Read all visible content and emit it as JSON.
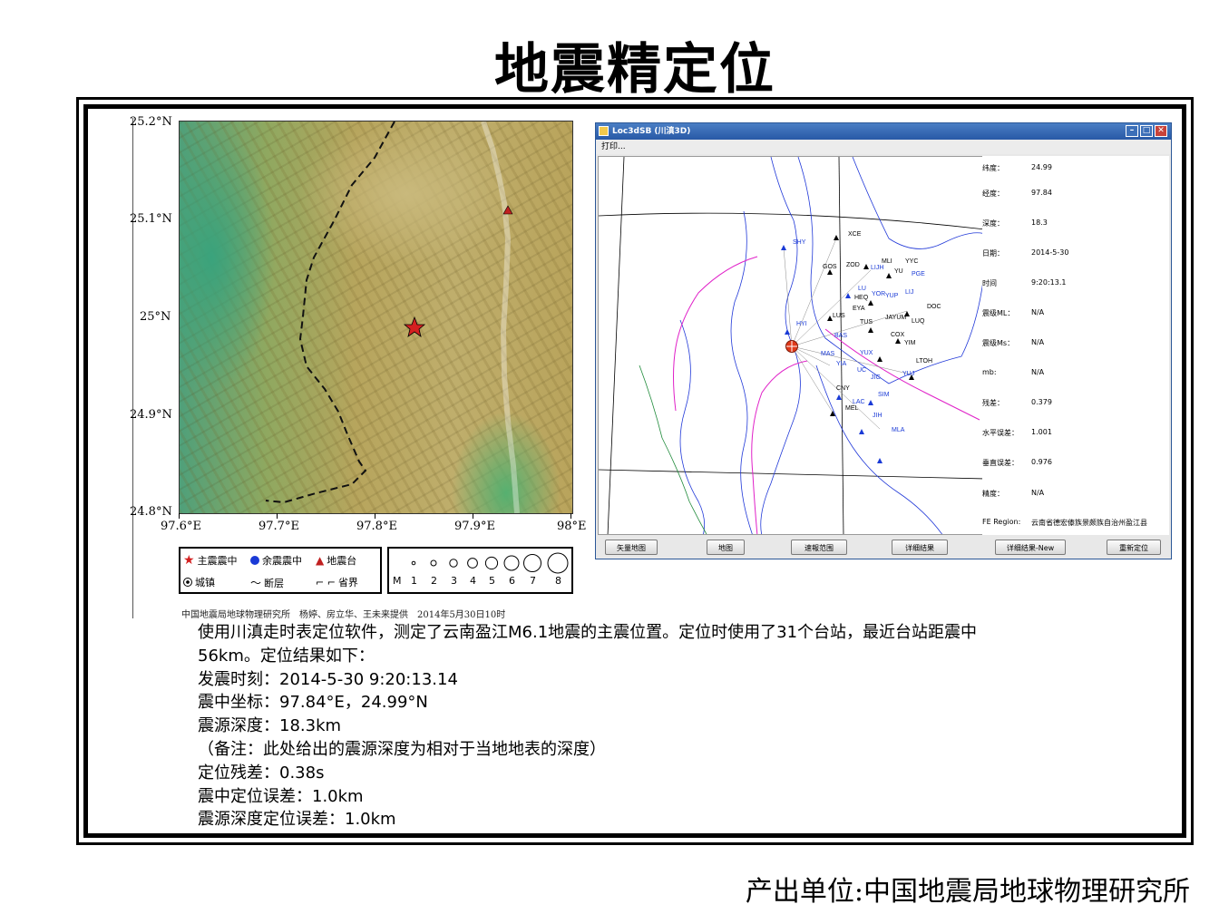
{
  "page": {
    "title": "地震精定位",
    "footer": "产出单位:中国地震局地球物理研究所"
  },
  "map": {
    "lat_labels": [
      "25.2°N",
      "25.1°N",
      "25°N",
      "24.9°N",
      "24.8°N"
    ],
    "lon_labels": [
      "97.6°E",
      "97.7°E",
      "97.8°E",
      "97.9°E",
      "98°E"
    ],
    "legend": {
      "main_shock": "主震震中",
      "aftershock": "余震震中",
      "station": "地震台",
      "town": "城镇",
      "fault": "断层",
      "province_boundary": "省界",
      "magnitude_prefix": "M",
      "magnitudes": [
        "1",
        "2",
        "3",
        "4",
        "5",
        "6",
        "7",
        "8"
      ]
    },
    "credit": "中国地震局地球物理研究所　杨婷、房立华、王未来提供　2014年5月30日10时",
    "colors": {
      "main_shock": "#d42020",
      "aftershock": "#1a3ad6",
      "station": "#c02020"
    }
  },
  "app": {
    "window_title": "Loc3dSB (川滇3D)",
    "menu": [
      "打印..."
    ],
    "results": [
      {
        "label": "纬度：",
        "value": "24.99"
      },
      {
        "label": "经度：",
        "value": "97.84"
      },
      {
        "label": "深度：",
        "value": "18.3"
      },
      {
        "label": "日期：",
        "value": "2014-5-30"
      },
      {
        "label": "时间",
        "value": "9:20:13.1"
      },
      {
        "label": "震级ML：",
        "value": "N/A"
      },
      {
        "label": "震级Ms：",
        "value": "N/A"
      },
      {
        "label": "mb:",
        "value": "N/A"
      },
      {
        "label": "残差：",
        "value": "0.379"
      },
      {
        "label": "水平误差：",
        "value": "1.001"
      },
      {
        "label": "垂直误差：",
        "value": "0.976"
      },
      {
        "label": "精度：",
        "value": "N/A"
      },
      {
        "label": "FE Region:",
        "value": "云南省德宏傣族景颇族自治州盈江县"
      }
    ],
    "buttons": [
      "矢量地图",
      "地图",
      "速報范围",
      "详细结果",
      "详细结果-New",
      "重新定位"
    ],
    "stations": [
      "XCE",
      "SHY",
      "GOS",
      "ZOD",
      "MLI",
      "LIJH",
      "YYC",
      "YU",
      "PGE",
      "LU",
      "YOR",
      "HEQ",
      "YUP",
      "LIJ",
      "EYA",
      "DOC",
      "LUS",
      "JAYUM",
      "LUQ",
      "TUS",
      "HYI",
      "COX",
      "YIM",
      "BAS",
      "YUX",
      "LTOH",
      "YUJ",
      "MAS",
      "UC",
      "YIA",
      "JIG",
      "SIM",
      "CNY",
      "LAC",
      "MEL",
      "JIH",
      "MLA"
    ]
  },
  "description": {
    "lines": [
      "使用川滇走时表定位软件，测定了云南盈江M6.1地震的主震位置。定位时使用了31个台站，最近台站距震中",
      "56km。定位结果如下：",
      "发震时刻：2014-5-30 9:20:13.14",
      "震中坐标：97.84°E，24.99°N",
      "震源深度：18.3km",
      "（备注：此处给出的震源深度为相对于当地地表的深度）",
      "定位残差：0.38s",
      "震中定位误差：1.0km",
      "震源深度定位误差：1.0km"
    ]
  }
}
